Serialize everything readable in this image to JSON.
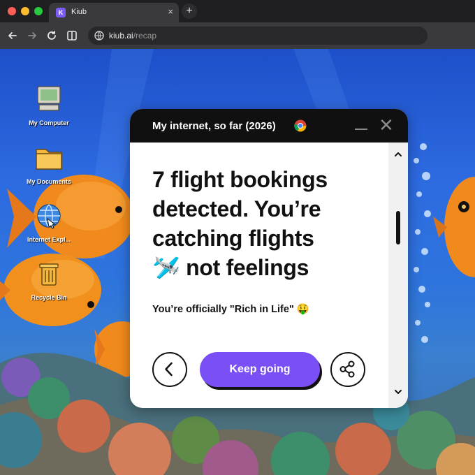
{
  "browser": {
    "tab_title": "Kiub",
    "tab_favicon_letter": "K",
    "new_tab_symbol": "+",
    "close_tab_symbol": "×",
    "url_host": "kiub.ai",
    "url_path": "/recap"
  },
  "desktop": {
    "icons": [
      {
        "label": "My Computer",
        "icon": "computer-icon"
      },
      {
        "label": "My Documents",
        "icon": "folder-icon"
      },
      {
        "label": "Internet Expl...",
        "icon": "internet-explorer-icon"
      },
      {
        "label": "Recycle Bin",
        "icon": "recycle-bin-icon"
      }
    ]
  },
  "popup": {
    "title": "My internet, so far (2026)",
    "headline_line1": "7 flight bookings",
    "headline_line2": "detected. You’re",
    "headline_line3": "catching flights",
    "headline_emoji": "🛩️",
    "headline_line4": " not feelings",
    "subline": "You’re officially \"Rich in Life\" 🤑",
    "primary_button": "Keep going",
    "back_symbol": "‹",
    "close_symbol": "✕"
  },
  "colors": {
    "accent": "#7a4ff5",
    "popup_header": "#101010",
    "wallpaper": "#2d6ae0"
  }
}
